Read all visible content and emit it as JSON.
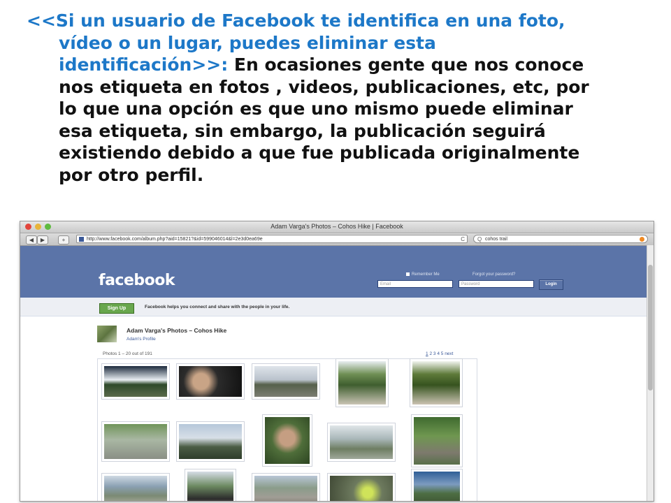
{
  "slide": {
    "quote_line1": "<<Si un usuario de Facebook te identifica en una foto,",
    "quote_line2": "vídeo o un lugar, puedes eliminar esta",
    "quote_line3": "identificación>>:",
    "body_line3": " En ocasiones gente que nos conoce",
    "body_line4": "nos etiqueta en fotos , videos, publicaciones, etc, por",
    "body_line5": "lo que una opción es que uno mismo puede eliminar",
    "body_line6": "esa etiqueta, sin embargo, la publicación seguirá",
    "body_line7": "existiendo debido a que fue publicada originalmente",
    "body_line8": "por otro perfil.",
    "quote_color": "#1d78c8"
  },
  "browser": {
    "window_title": "Adam Varga's Photos – Cohos Hike | Facebook",
    "back": "◀",
    "forward": "▶",
    "add": "+",
    "url": "http://www.facebook.com/album.php?aid=15821?&id=599046014&l=2e3d0ea69e",
    "reload": "C",
    "search_value": "cohos trail",
    "search_icon": "Q"
  },
  "fb": {
    "logo": "facebook",
    "remember_me": "Remember Me",
    "forgot": "Forgot your password?",
    "email_placeholder": "Email",
    "password_placeholder": "Password",
    "login": "Login",
    "signup": "Sign Up",
    "signup_text": "Facebook helps you connect and share with the people in your life.",
    "brand_color": "#5b74a8"
  },
  "album": {
    "title": "Adam Varga's Photos – Cohos Hike",
    "profile_link": "Adam's Profile",
    "photos_count": "Photos 1 – 20 out of 191",
    "pages": [
      "1",
      "2",
      "3",
      "4",
      "5",
      "next"
    ]
  }
}
